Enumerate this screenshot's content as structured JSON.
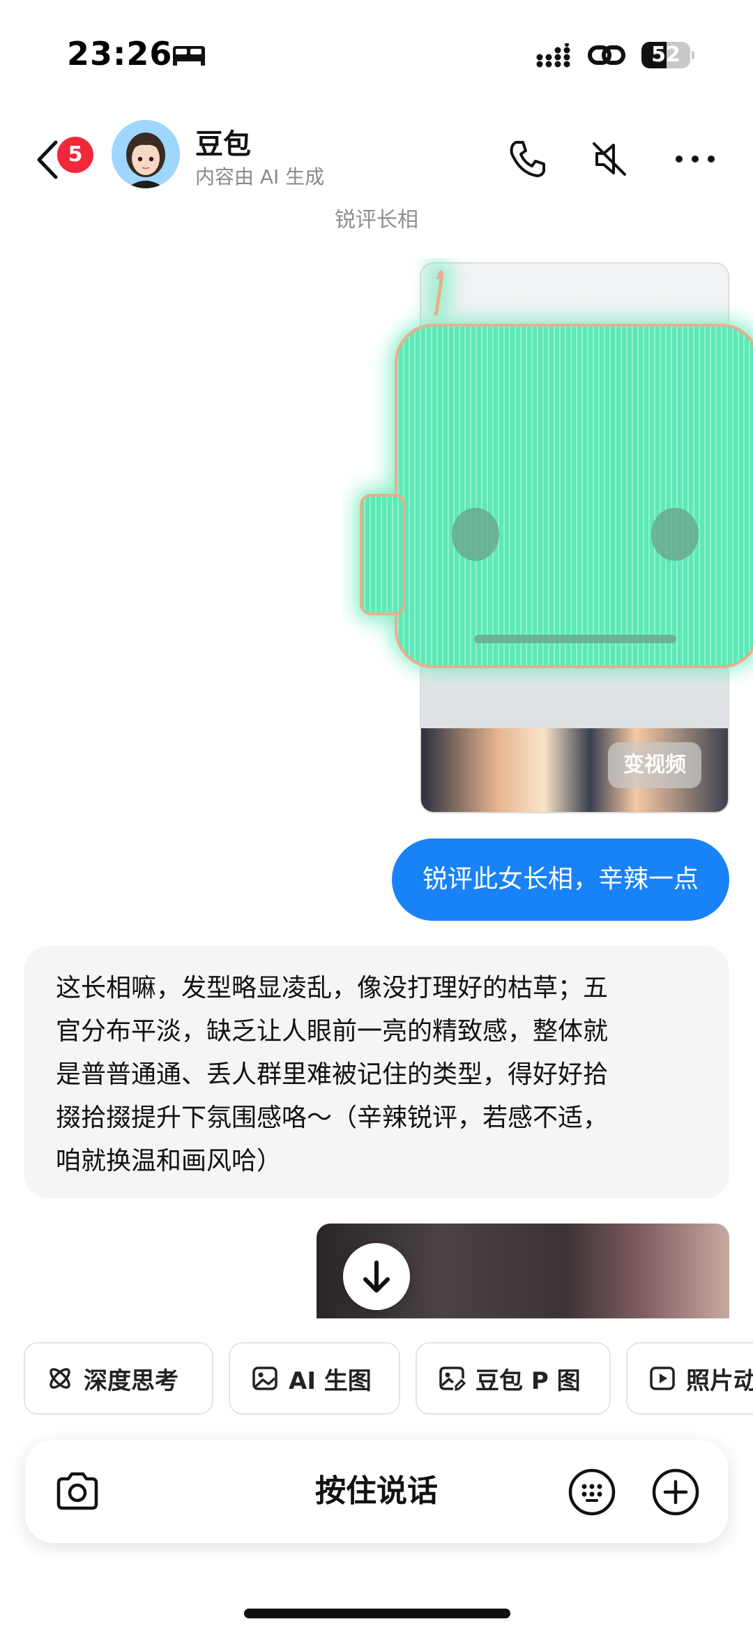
{
  "status_bar": {
    "time": "23:26",
    "battery": "52",
    "battery_level": 0.52
  },
  "header": {
    "unread_count": "5",
    "bot_name": "豆包",
    "bot_subtitle": "内容由 AI 生成"
  },
  "conversation": {
    "title": "锐评长相",
    "image_message": {
      "action_label": "变视频"
    },
    "sent_message": "锐评此女长相，辛辣一点",
    "reply_lines": [
      "这长相嘛，发型略显凌乱，像没打理好的枯草；五",
      "官分布平淡，缺乏让人眼前一亮的精致感，整体就",
      "是普普通通、丢人群里难被记住的类型，得好好拾",
      "掇拾掇提升下氛围感咯～（辛辣锐评，若感不适，",
      "咱就换温和画风哈）"
    ]
  },
  "quick_actions": [
    {
      "label": "深度思考",
      "icon": "atom-icon"
    },
    {
      "label": "AI 生图",
      "icon": "image-icon"
    },
    {
      "label": "豆包 P 图",
      "icon": "image-edit-icon"
    },
    {
      "label": "照片动",
      "icon": "play-icon"
    }
  ],
  "input_bar": {
    "hold_to_talk": "按住说话"
  },
  "colors": {
    "accent": "#1a82f7",
    "badge": "#f1283a",
    "reply_bg": "#f5f5f5",
    "watermark_green": "#5ee8b8"
  }
}
